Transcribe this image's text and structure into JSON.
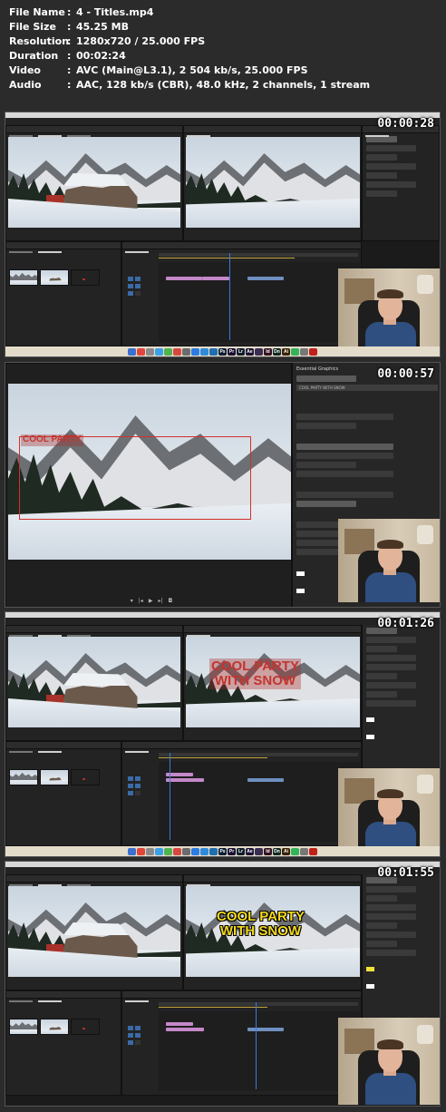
{
  "info": {
    "rows": [
      {
        "key": "File Name",
        "value": "4 - Titles.mp4"
      },
      {
        "key": "File Size",
        "value": "45.25 MB"
      },
      {
        "key": "Resolution",
        "value": "1280x720 / 25.000 FPS"
      },
      {
        "key": "Duration",
        "value": "00:02:24"
      },
      {
        "key": "Video",
        "value": "AVC (Main@L3.1), 2 504 kb/s, 25.000 FPS"
      },
      {
        "key": "Audio",
        "value": "AAC, 128 kb/s (CBR), 48.0 kHz, 2 channels, 1 stream"
      }
    ],
    "colon": ":"
  },
  "thumbnails": [
    {
      "timestamp": "00:00:28"
    },
    {
      "timestamp": "00:00:57",
      "panel_title": "Essential Graphics",
      "layer_name": "COOL PARTY WITH SNOW",
      "overlay_text": "COOL PARTY"
    },
    {
      "timestamp": "00:01:26",
      "overlay_line1": "COOL PARTY",
      "overlay_line2": "WITH SNOW"
    },
    {
      "timestamp": "00:01:55",
      "overlay_line1": "COOL PARTY",
      "overlay_line2": "WITH SNOW"
    }
  ],
  "dock_icons": [
    {
      "label": "",
      "color": "#3b6fd1"
    },
    {
      "label": "",
      "color": "#e0463c"
    },
    {
      "label": "",
      "color": "#8a8a8a"
    },
    {
      "label": "",
      "color": "#3aa0e8"
    },
    {
      "label": "",
      "color": "#4fb34f"
    },
    {
      "label": "",
      "color": "#d6483f"
    },
    {
      "label": "",
      "color": "#6c6c6c"
    },
    {
      "label": "",
      "color": "#2d7be5"
    },
    {
      "label": "",
      "color": "#2f8ad9"
    },
    {
      "label": "",
      "color": "#1f6fb0"
    },
    {
      "label": "Ps",
      "color": "#0a1d33"
    },
    {
      "label": "Pr",
      "color": "#1a0f33"
    },
    {
      "label": "Lr",
      "color": "#0d1e2a"
    },
    {
      "label": "Ae",
      "color": "#1a1233"
    },
    {
      "label": "",
      "color": "#3a2d52"
    },
    {
      "label": "Id",
      "color": "#331020"
    },
    {
      "label": "Dn",
      "color": "#0f2a22"
    },
    {
      "label": "Ai",
      "color": "#3a2200"
    },
    {
      "label": "",
      "color": "#33b35a"
    },
    {
      "label": "",
      "color": "#777777"
    },
    {
      "label": "",
      "color": "#c0201a"
    }
  ],
  "colors": {
    "title_red": "#c2352e",
    "title_yellow": "#f3d91d",
    "timeline_clip_pink": "#c488c9",
    "timeline_clip_blue": "#6e8fbf",
    "playhead": "#3b7ae0"
  }
}
